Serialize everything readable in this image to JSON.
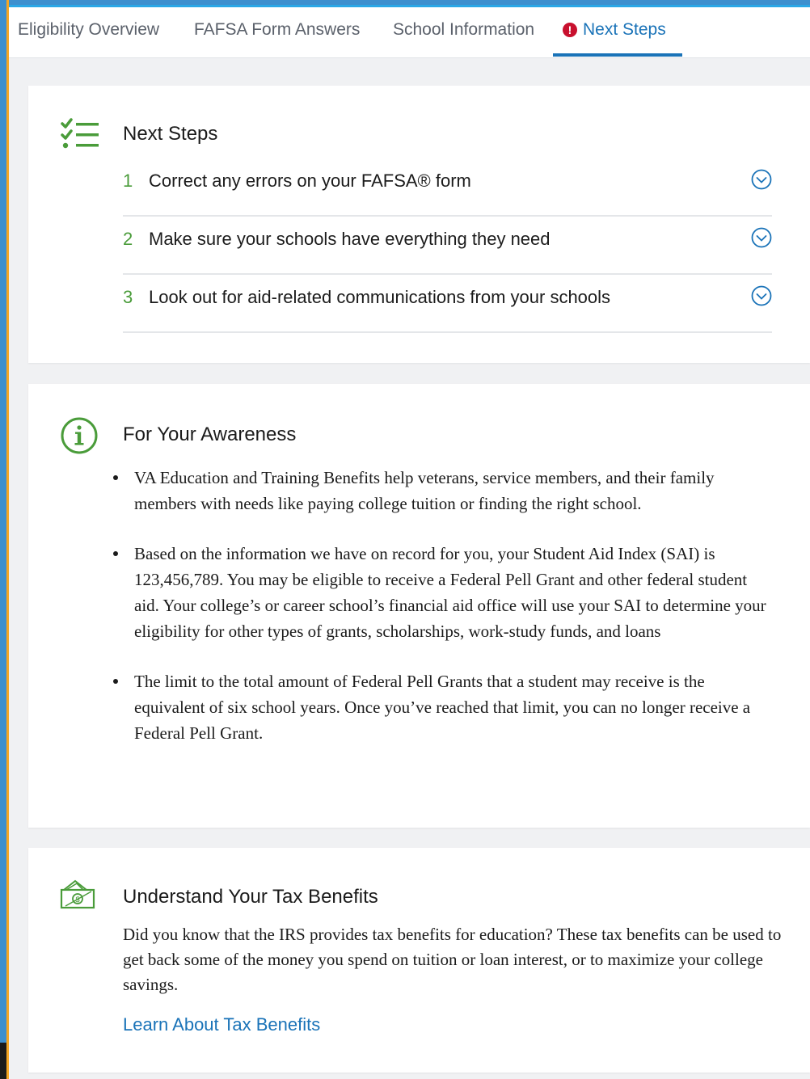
{
  "tabs": [
    {
      "label": "Eligibility Overview"
    },
    {
      "label": "FAFSA Form Answers"
    },
    {
      "label": "School Information"
    },
    {
      "label": "Next Steps",
      "active": true,
      "alert": true
    }
  ],
  "next_steps": {
    "title": "Next Steps",
    "items": [
      {
        "number": "1",
        "text": "Correct any errors on your FAFSA® form"
      },
      {
        "number": "2",
        "text": "Make sure your schools have everything they need"
      },
      {
        "number": "3",
        "text": "Look out for aid-related communications from your schools"
      }
    ]
  },
  "awareness": {
    "title": "For Your Awareness",
    "bullets": [
      "VA Education and Training Benefits help veterans, service members, and their family members with needs like paying college tuition or finding the right school.",
      "Based on the information we have on record for you, your Student Aid Index (SAI) is 123,456,789. You may be eligible to receive a Federal Pell Grant and other federal student aid. Your college’s or career school’s financial aid office will use your SAI to determine your eligibility for other types of grants, scholarships, work-study funds, and loans",
      "The limit to the total amount of Federal Pell Grants that a student may receive is the equivalent of six school years. Once you’ve reached that limit, you can no longer receive a Federal Pell Grant."
    ]
  },
  "tax": {
    "title": "Understand Your Tax Benefits",
    "body": "Did you know that the IRS provides tax benefits for education? These tax benefits can be used to get back some of the money you spend on tuition or loan interest, or to maximize your college savings.",
    "link": "Learn About Tax Benefits"
  },
  "colors": {
    "accent_blue": "#1a73b8",
    "success_green": "#4a9c3a",
    "alert_red": "#c8102e",
    "frame_orange": "#f5a623"
  },
  "icons": {
    "checklist": "checklist-icon",
    "info": "info-circle-icon",
    "money": "money-bill-icon",
    "chevron": "chevron-down-circle-icon",
    "alert": "alert-circle-icon"
  }
}
